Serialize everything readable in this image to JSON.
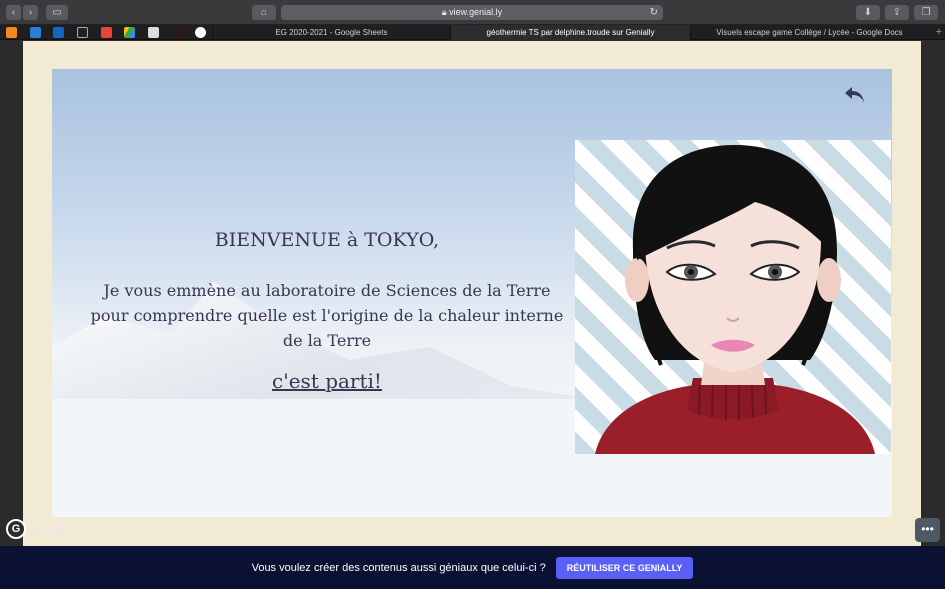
{
  "browser": {
    "url": "view.genial.ly",
    "tabs": [
      {
        "label": "EG 2020-2021 - Google Sheets",
        "active": false
      },
      {
        "label": "géothermie TS par delphine.troude sur Genially",
        "active": true
      },
      {
        "label": "Visuels escape game Collège / Lycée - Google Docs",
        "active": false
      }
    ],
    "bookmark_icons": [
      "orange-icon",
      "bird-icon",
      "outlook-icon",
      "pix-icon",
      "gmail-icon",
      "drive-icon",
      "nike-icon",
      "dark-icon",
      "google-icon"
    ]
  },
  "scene": {
    "welcome": "BIENVENUE à TOKYO,",
    "intro": "Je vous emmène au laboratoire de Sciences de la Terre pour comprendre quelle est l'origine de la chaleur interne de la Terre",
    "start_link": "c'est parti!"
  },
  "footer": {
    "logo_text": "genially",
    "promo_text": "Vous voulez créer des contenus aussi géniaux que celui-ci ?",
    "cta_label": "RÉUTILISER CE GENIALLY"
  },
  "colors": {
    "paper": "#f3ead4",
    "text": "#3a3550",
    "bottom_bar": "#0b1133",
    "cta": "#5a5ff5",
    "sweater": "#9a1f2b"
  }
}
